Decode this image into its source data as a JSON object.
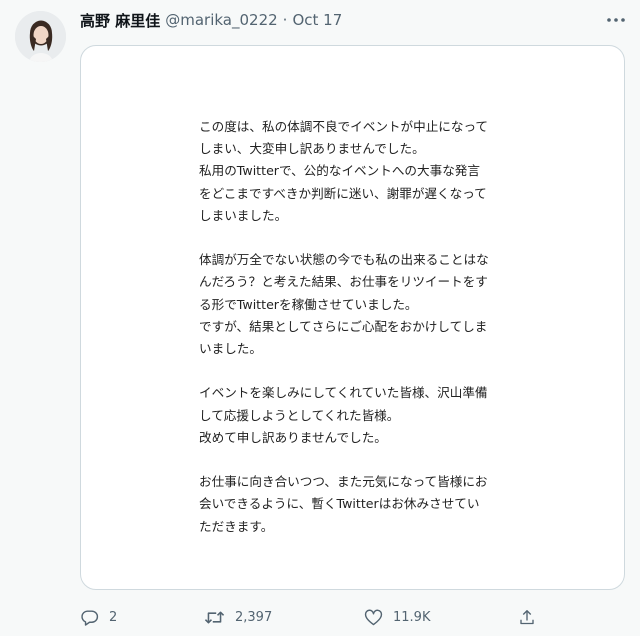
{
  "tweet": {
    "display_name": "高野 麻里佳",
    "handle": "@marika_0222",
    "separator": "·",
    "date": "Oct 17",
    "letter": [
      [
        "この度は、私の体調不良でイベントが中止になって",
        "しまい、大変申し訳ありませんでした。",
        "私用のTwitterで、公的なイベントへの大事な発言",
        "をどこまですべきか判断に迷い、謝罪が遅くなって",
        "しまいました。"
      ],
      [
        "体調が万全でない状態の今でも私の出来ることはな",
        "んだろう？と考えた結果、お仕事をリツイートをす",
        "る形でTwitterを稼働させていました。",
        "ですが、結果としてさらにご心配をおかけしてしま",
        "いました。"
      ],
      [
        "イベントを楽しみにしてくれていた皆様、沢山準備",
        "して応援しようとしてくれた皆様。",
        "改めて申し訳ありませんでした。"
      ],
      [
        "お仕事に向き合いつつ、また元気になって皆様にお",
        "会いできるように、暫くTwitterはお休みさせてい",
        "ただきます。"
      ]
    ],
    "actions": {
      "reply_count": "2",
      "retweet_count": "2,397",
      "like_count": "11.9K"
    }
  },
  "icons": {
    "avatar": "avatar-photo",
    "more": "more-horizontal-icon",
    "reply": "reply-icon",
    "retweet": "retweet-icon",
    "like": "heart-icon",
    "share": "share-icon"
  },
  "colors": {
    "background": "#f7f9f9",
    "text_primary": "#0f1419",
    "text_secondary": "#536471",
    "border": "#cfd9de"
  }
}
